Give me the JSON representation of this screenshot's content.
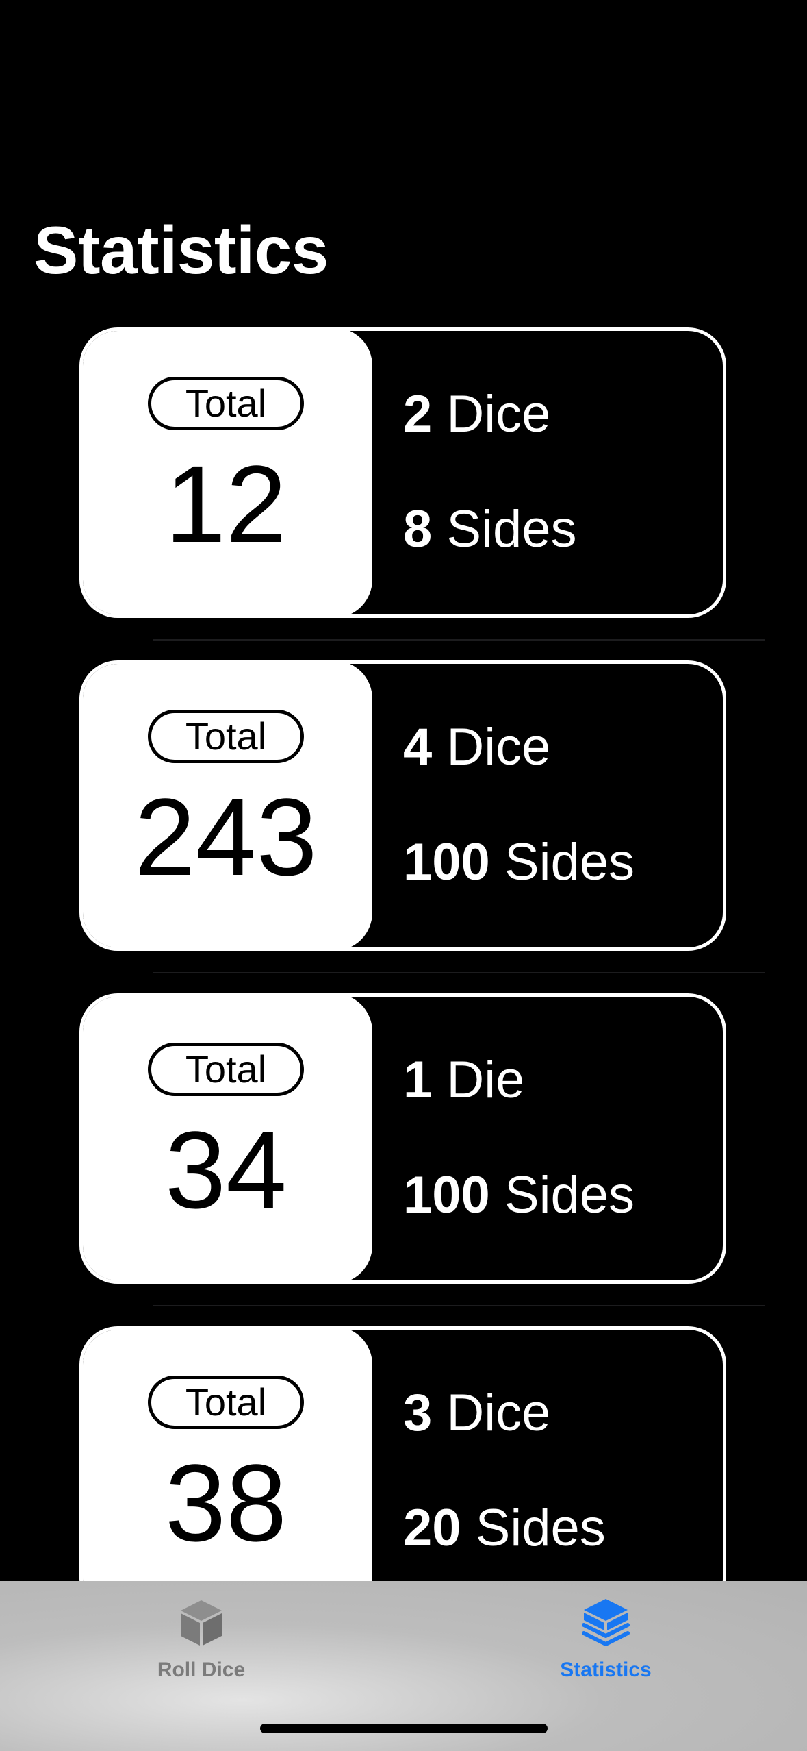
{
  "header": {
    "title": "Statistics"
  },
  "rolls": [
    {
      "total_label": "Total",
      "total": "12",
      "dice_count": "2",
      "dice_word": "Dice",
      "sides_count": "8",
      "sides_word": "Sides"
    },
    {
      "total_label": "Total",
      "total": "243",
      "dice_count": "4",
      "dice_word": "Dice",
      "sides_count": "100",
      "sides_word": "Sides"
    },
    {
      "total_label": "Total",
      "total": "34",
      "dice_count": "1",
      "dice_word": "Die",
      "sides_count": "100",
      "sides_word": "Sides"
    },
    {
      "total_label": "Total",
      "total": "38",
      "dice_count": "3",
      "dice_word": "Dice",
      "sides_count": "20",
      "sides_word": "Sides"
    }
  ],
  "tab_bar": {
    "tabs": [
      {
        "label": "Roll Dice",
        "icon": "cube-icon",
        "selected": false
      },
      {
        "label": "Statistics",
        "icon": "stack-icon",
        "selected": true
      }
    ],
    "colors": {
      "selected": "#1877f2",
      "unselected": "#7b7b7b"
    }
  }
}
